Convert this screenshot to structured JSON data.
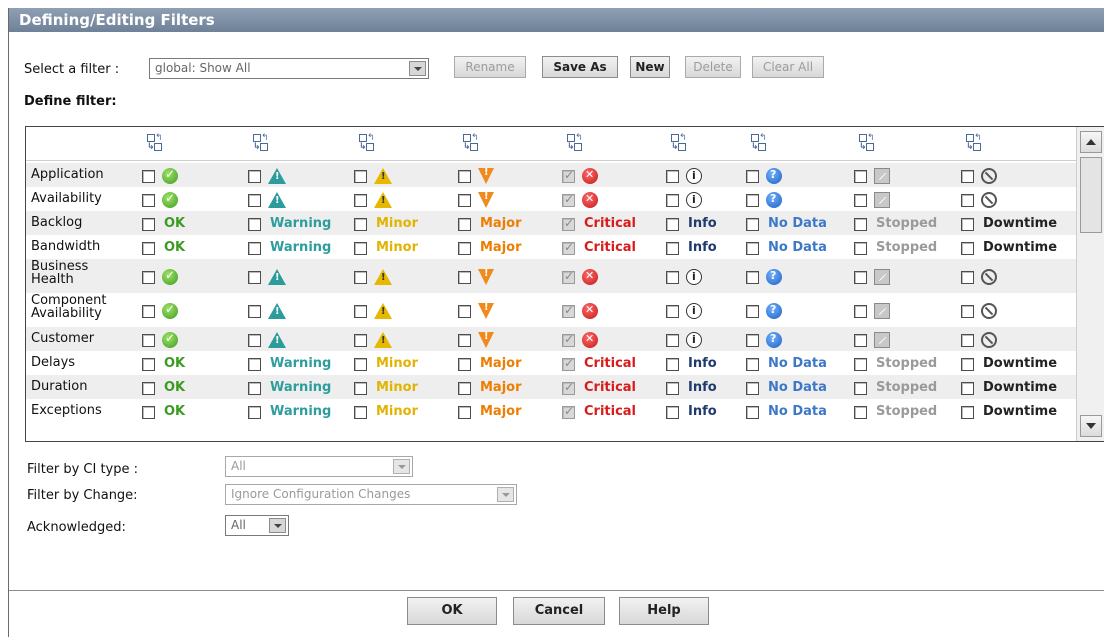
{
  "dialog": {
    "title": "Defining/Editing Filters"
  },
  "filter_select": {
    "label": "Select a filter :",
    "value": "global: Show All"
  },
  "toolbar": {
    "rename": "Rename",
    "save_as": "Save As",
    "new": "New",
    "delete": "Delete",
    "clear_all": "Clear All"
  },
  "define_filter_label": "Define filter:",
  "statuses": [
    {
      "key": "ok",
      "label": "OK",
      "checked": false
    },
    {
      "key": "warning",
      "label": "Warning",
      "checked": false
    },
    {
      "key": "minor",
      "label": "Minor",
      "checked": false
    },
    {
      "key": "major",
      "label": "Major",
      "checked": false
    },
    {
      "key": "critical",
      "label": "Critical",
      "checked": true
    },
    {
      "key": "info",
      "label": "Info",
      "checked": false
    },
    {
      "key": "nodata",
      "label": "No Data",
      "checked": false
    },
    {
      "key": "stopped",
      "label": "Stopped",
      "checked": false
    },
    {
      "key": "downtime",
      "label": "Downtime",
      "checked": false
    }
  ],
  "rows": [
    {
      "name": "Application",
      "mode": "icon"
    },
    {
      "name": "Availability",
      "mode": "icon"
    },
    {
      "name": "Backlog",
      "mode": "text"
    },
    {
      "name": "Bandwidth",
      "mode": "text"
    },
    {
      "name": "Business Health",
      "mode": "icon"
    },
    {
      "name": "Component Availability",
      "mode": "icon"
    },
    {
      "name": "Customer",
      "mode": "icon"
    },
    {
      "name": "Delays",
      "mode": "text"
    },
    {
      "name": "Duration",
      "mode": "text"
    },
    {
      "name": "Exceptions",
      "mode": "text"
    }
  ],
  "filters": {
    "ci_type_label": "Filter by CI type :",
    "ci_type_value": "All",
    "change_label": "Filter by Change:",
    "change_value": "Ignore Configuration Changes",
    "ack_label": "Acknowledged:",
    "ack_value": "All"
  },
  "footer": {
    "ok": "OK",
    "cancel": "Cancel",
    "help": "Help"
  }
}
